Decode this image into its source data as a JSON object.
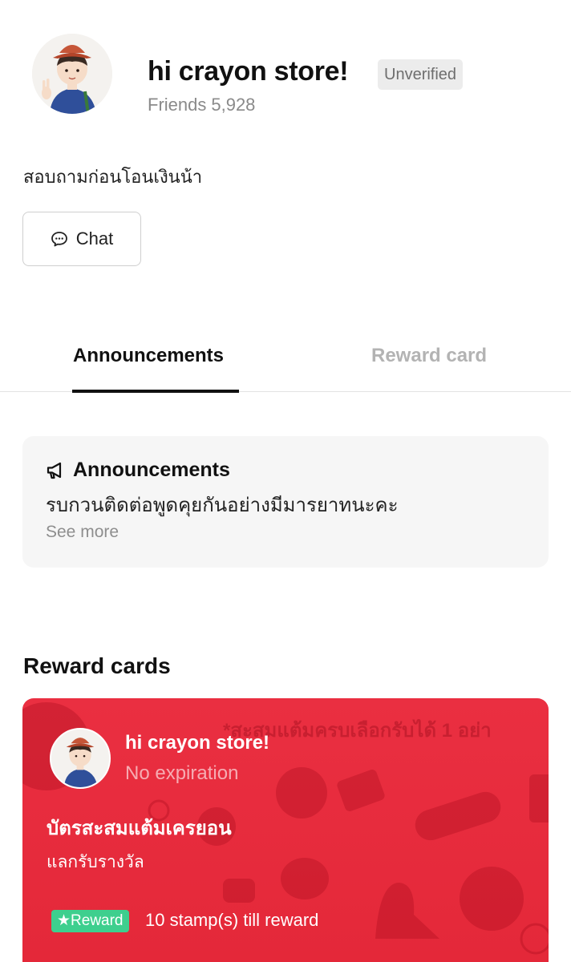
{
  "profile": {
    "name": "hi crayon store!",
    "badge": "Unverified",
    "friends_label": "Friends",
    "friends_count": "5,928",
    "status_message": "สอบถามก่อนโอนเงินน้า"
  },
  "actions": {
    "chat_label": "Chat"
  },
  "tabs": [
    {
      "label": "Announcements",
      "active": true
    },
    {
      "label": "Reward card",
      "active": false
    }
  ],
  "announcement": {
    "title": "Announcements",
    "text": "รบกวนติดต่อพูดคุยกันอย่างมีมารยาทนะคะ",
    "see_more": "See more"
  },
  "reward_section": {
    "heading": "Reward cards",
    "card": {
      "store_name": "hi crayon store!",
      "expiry": "No expiration",
      "banner_text": "*สะสมแต้มครบเลือกรับได้ 1 อย่า",
      "title": "บัตรสะสมแต้มเครยอน",
      "subtitle": "แลกรับรางวัล",
      "tag": "★Reward",
      "stamps_text": "10 stamp(s) till reward",
      "color": "#e52a3b"
    }
  },
  "icons": [
    "avatar-illustration",
    "chat-bubble-icon",
    "megaphone-icon"
  ]
}
